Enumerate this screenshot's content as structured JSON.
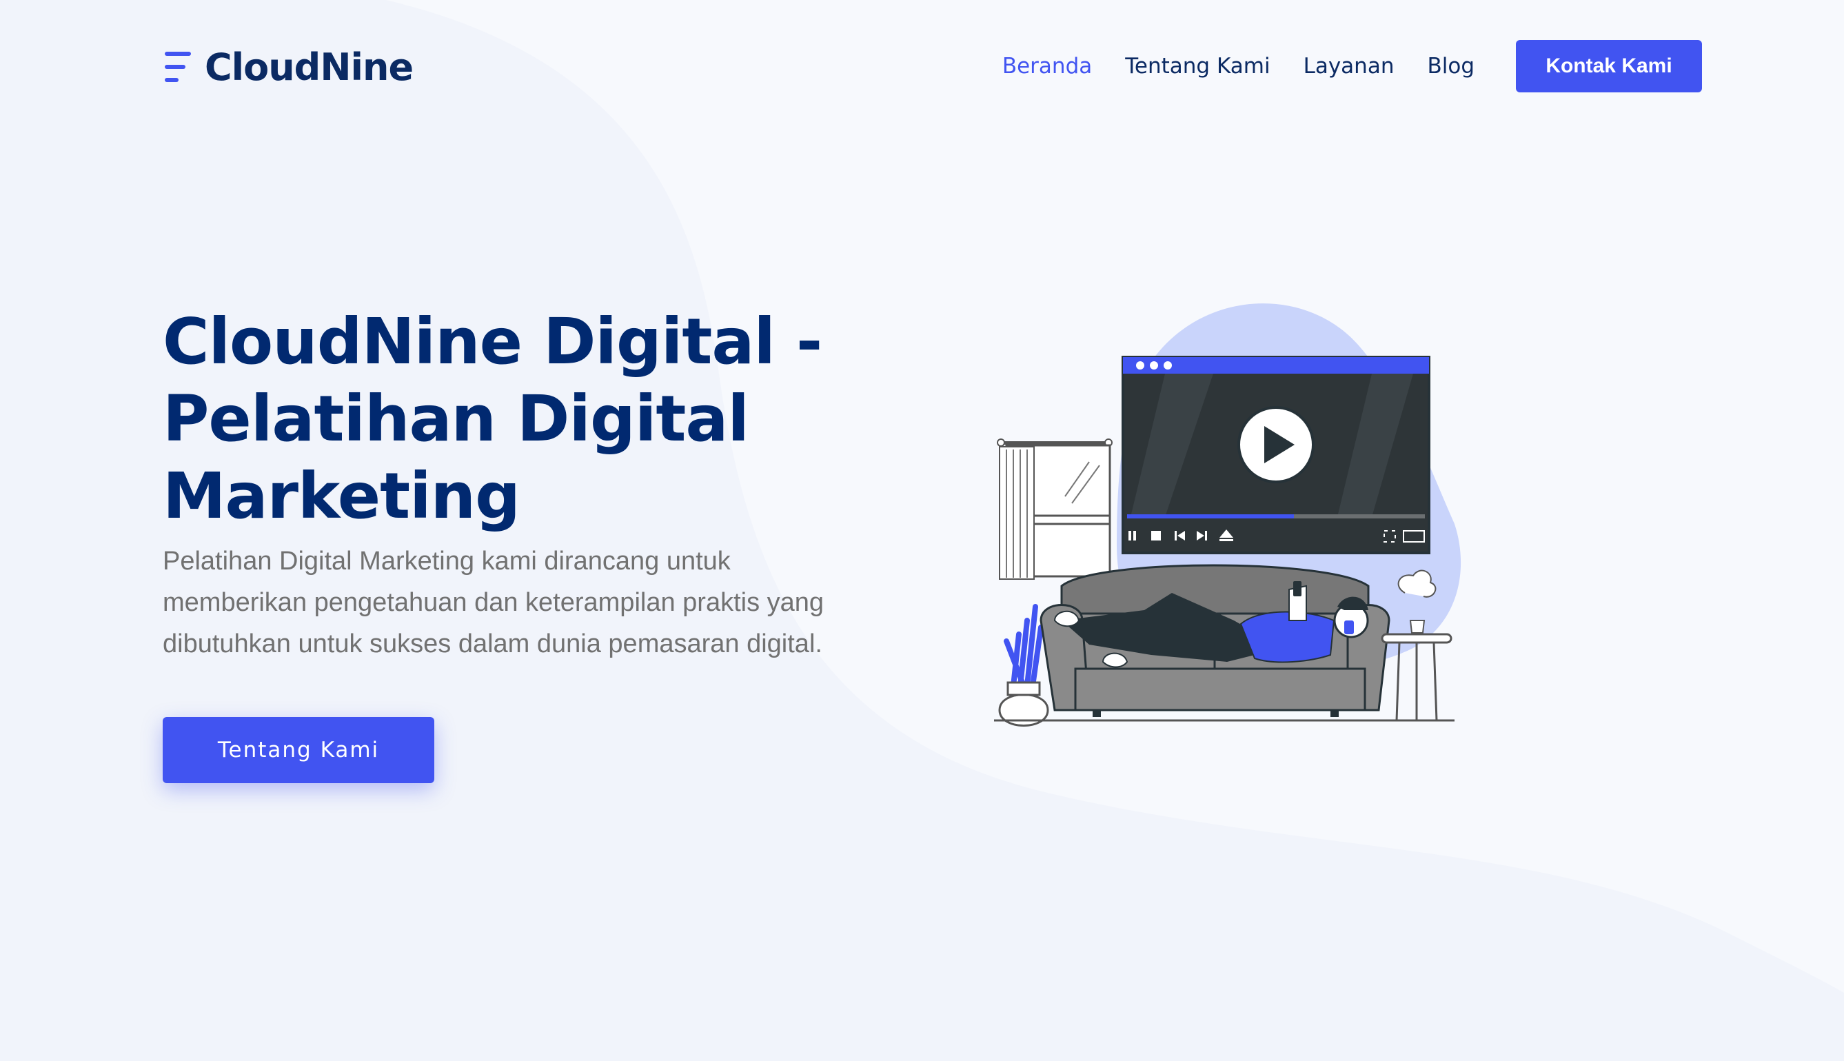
{
  "brand": {
    "name": "CloudNine",
    "logo_icon": "menu-lines-icon",
    "primary_color": "#4154f1",
    "heading_color": "#012970"
  },
  "nav": {
    "items": [
      {
        "label": "Beranda",
        "active": true
      },
      {
        "label": "Tentang Kami",
        "active": false
      },
      {
        "label": "Layanan",
        "active": false
      },
      {
        "label": "Blog",
        "active": false
      }
    ],
    "cta_label": "Kontak Kami"
  },
  "hero": {
    "title": "CloudNine Digital - Pelatihan Digital Marketing",
    "description": "Pelatihan Digital Marketing kami dirancang untuk memberikan pengetahuan dan keterampilan praktis yang dibutuhkan untuk sukses dalam dunia pemasaran digital.",
    "button_label": "Tentang Kami",
    "illustration": "person-relaxing-on-sofa-watching-video-illustration"
  }
}
